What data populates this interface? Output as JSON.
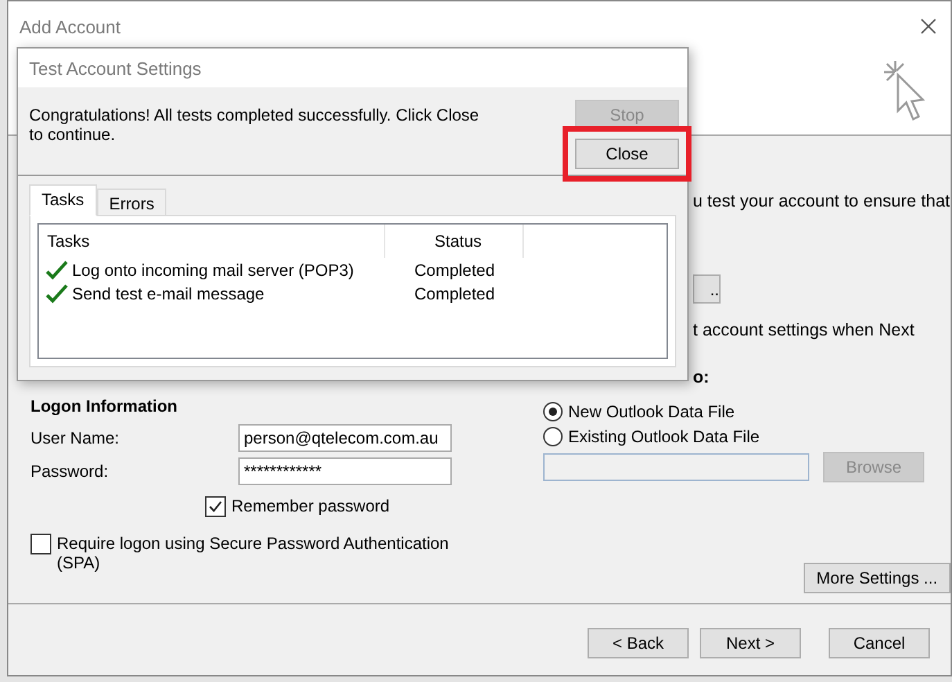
{
  "window": {
    "title": "Add Account"
  },
  "right_column": {
    "partial_texts": [
      {
        "kind": "text",
        "text": "u test your account to ensure that"
      },
      {
        "kind": "button",
        "text": ".."
      },
      {
        "kind": "text",
        "text": "t account settings when Next"
      },
      {
        "kind": "heading",
        "text": "o:"
      }
    ],
    "data_file_options": [
      {
        "label": "New Outlook Data File",
        "selected": true
      },
      {
        "label": "Existing Outlook Data File",
        "selected": false
      }
    ],
    "browse_button": {
      "label": "Browse",
      "disabled": true
    },
    "more_settings_button": {
      "label": "More Settings ..."
    }
  },
  "logon": {
    "heading": "Logon Information",
    "user_name": {
      "label": "User Name:",
      "value": "person@qtelecom.com.au"
    },
    "password": {
      "label": "Password:",
      "value": "************"
    },
    "remember_password": {
      "label": "Remember password",
      "checked": true
    },
    "spa": {
      "label": "Require logon using Secure Password Authentication (SPA)",
      "checked": false
    }
  },
  "footer_buttons": [
    {
      "label": "< Back"
    },
    {
      "label": "Next >"
    },
    {
      "label": "Cancel"
    }
  ],
  "test_dialog": {
    "title": "Test Account Settings",
    "message": "Congratulations! All tests completed successfully. Click Close to continue.",
    "buttons": [
      {
        "label": "Stop",
        "disabled": true,
        "highlighted": false
      },
      {
        "label": "Close",
        "disabled": false,
        "highlighted": true
      }
    ],
    "tabs": [
      {
        "label": "Tasks",
        "selected": true
      },
      {
        "label": "Errors",
        "selected": false
      }
    ],
    "columns": [
      "Tasks",
      "Status"
    ],
    "rows": [
      {
        "task": "Log onto incoming mail server (POP3)",
        "status": "Completed",
        "done": true
      },
      {
        "task": "Send test e-mail message",
        "status": "Completed",
        "done": true
      }
    ]
  }
}
